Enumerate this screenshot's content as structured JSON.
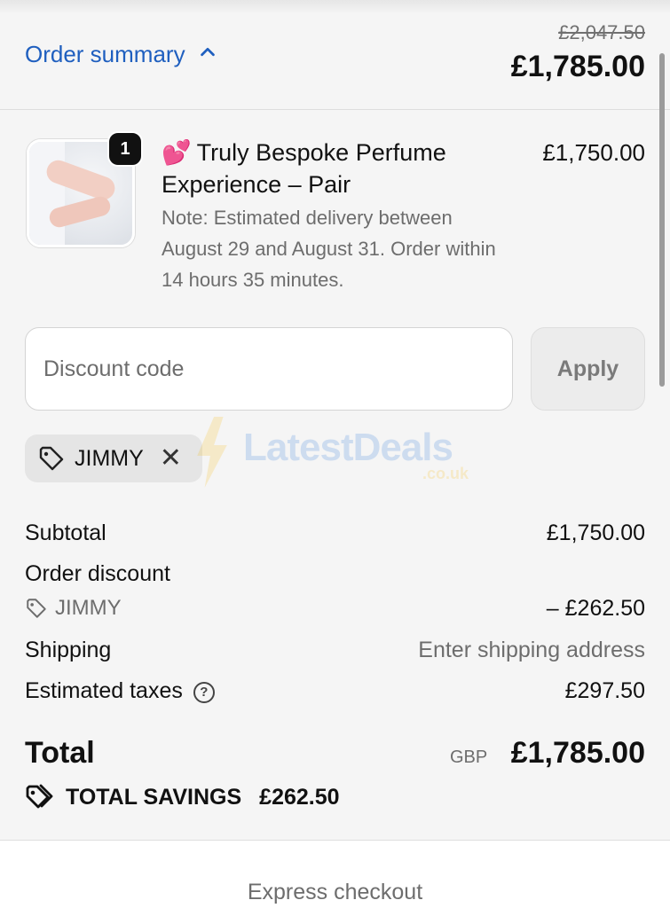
{
  "header": {
    "toggle_label": "Order summary",
    "original_total": "£2,047.50",
    "total": "£1,785.00"
  },
  "product": {
    "quantity": "1",
    "emoji": "💕",
    "title": "Truly Bespoke Perfume Experience – Pair",
    "note": "Note: Estimated delivery between August 29 and August 31. Order within 14 hours 35 minutes.",
    "price": "£1,750.00"
  },
  "discount": {
    "placeholder": "Discount code",
    "apply_label": "Apply",
    "applied_code": "JIMMY"
  },
  "watermark": {
    "text": "LatestDeals",
    "sub": ".co.uk"
  },
  "summary": {
    "subtotal_label": "Subtotal",
    "subtotal_value": "£1,750.00",
    "discount_label": "Order discount",
    "discount_code": "JIMMY",
    "discount_value": "– £262.50",
    "shipping_label": "Shipping",
    "shipping_value": "Enter shipping address",
    "taxes_label": "Estimated taxes",
    "taxes_value": "£297.50"
  },
  "total": {
    "label": "Total",
    "currency": "GBP",
    "value": "£1,785.00",
    "savings_label": "TOTAL SAVINGS",
    "savings_value": "£262.50"
  },
  "footer": {
    "express_label": "Express checkout"
  },
  "colors": {
    "link": "#1f5fbf",
    "background": "#f5f5f5",
    "text": "#111111",
    "muted": "#6d6d6d"
  }
}
